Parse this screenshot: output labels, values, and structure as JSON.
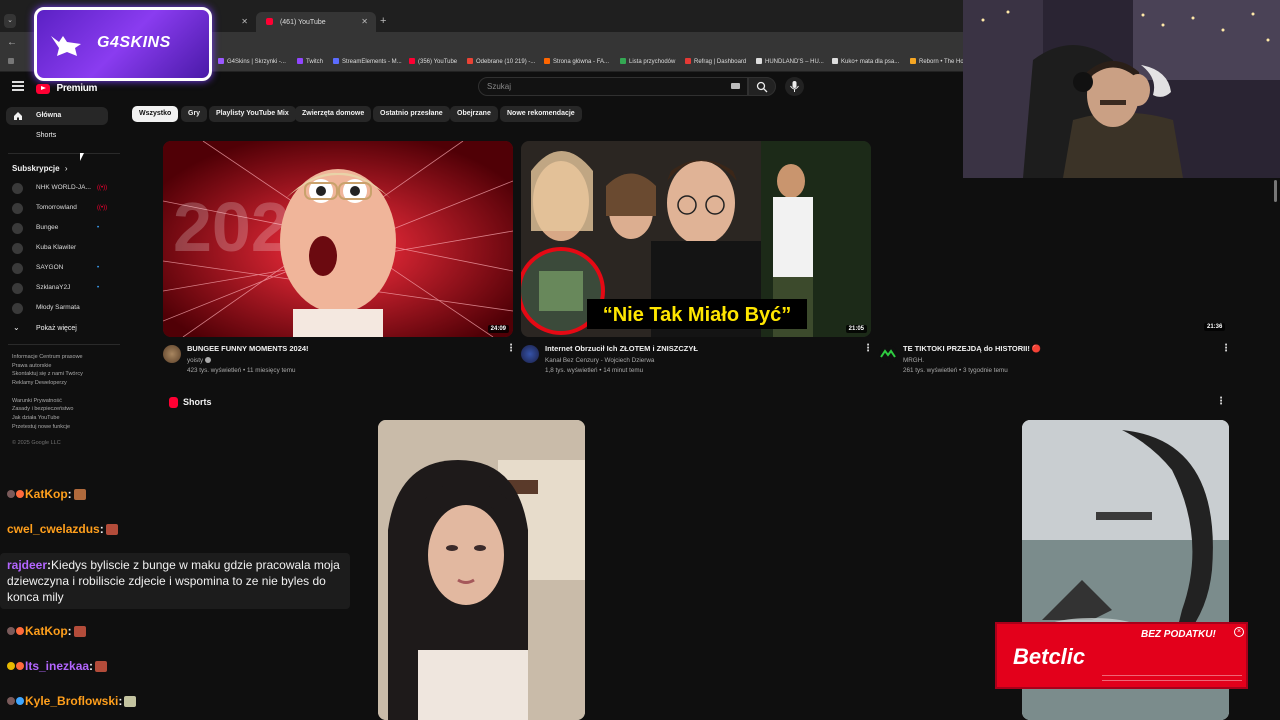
{
  "browser": {
    "tabs": [
      {
        "label": ""
      },
      {
        "label": "(461) YouTube"
      }
    ],
    "new_tab": "+",
    "bookmarks": [
      {
        "label": "G4Skins | Skrzynki -...",
        "color": "#9b59ff"
      },
      {
        "label": "Twitch",
        "color": "#9146ff"
      },
      {
        "label": "StreamElements - M...",
        "color": "#5b6cff"
      },
      {
        "label": "(356) YouTube",
        "color": "#ff0033"
      },
      {
        "label": "Odebrane (10 219) -...",
        "color": "#ea4335"
      },
      {
        "label": "Strona główna - FA...",
        "color": "#ff6600"
      },
      {
        "label": "Lista przychodów",
        "color": "#34a853"
      },
      {
        "label": "Refrag | Dashboard",
        "color": "#e53935"
      },
      {
        "label": "HUNDLAND'S – HU...",
        "color": "#dddddd"
      },
      {
        "label": "Kuko+ mata dla psa...",
        "color": "#dddddd"
      },
      {
        "label": "Reborn • The Ho",
        "color": "#f5a623"
      }
    ]
  },
  "overlay": {
    "g4skins_label": "G4SKINS"
  },
  "youtube": {
    "logo_text": "Premium",
    "search_placeholder": "Szukaj",
    "chips": [
      "Wszystko",
      "Gry",
      "Playlisty YouTube Mix",
      "Zwierzęta domowe",
      "Ostatnio przesłane",
      "Obejrzane",
      "Nowe rekomendacje"
    ],
    "sidebar": {
      "main": [
        {
          "label": "Główna",
          "icon": "home-icon"
        },
        {
          "label": "Shorts",
          "icon": "shorts-icon"
        }
      ],
      "subscriptions_title": "Subskrypcje",
      "subscriptions_arrow": "›",
      "subscriptions": [
        {
          "label": "NHK WORLD-JA...",
          "dot": "((•))",
          "dot_color": "#ff0033"
        },
        {
          "label": "Tomorrowland",
          "dot": "((•))",
          "dot_color": "#ff0033"
        },
        {
          "label": "Bungee",
          "dot": "•",
          "dot_color": "#3ea6ff"
        },
        {
          "label": "Kuba Klawiter",
          "dot": "",
          "dot_color": "#3ea6ff"
        },
        {
          "label": "SAYGON",
          "dot": "•",
          "dot_color": "#3ea6ff"
        },
        {
          "label": "SzklanaY2J",
          "dot": "•",
          "dot_color": "#3ea6ff"
        },
        {
          "label": "Młody Sarmata",
          "dot": "",
          "dot_color": "#3ea6ff"
        }
      ],
      "show_more": "Pokaż więcej",
      "footer_lines": [
        "Informacje  Centrum prasowe",
        "Prawa autorskie",
        "Skontaktuj się z nami  Twórcy",
        "Reklamy  Deweloperzy",
        "",
        "Warunki  Prywatność",
        "Zasady i bezpieczeństwo",
        "Jak działa YouTube",
        "Przetestuj nowe funkcje"
      ],
      "copyright": "© 2025 Google LLC"
    },
    "videos": [
      {
        "title": "BUNGEE FUNNY MOMENTS 2024!",
        "channel": "yoisty",
        "meta": "423 tys. wyświetleń • 11 miesięcy temu",
        "duration": "24:09",
        "thumb_text": "2024"
      },
      {
        "title": "Internet Obrzucił Ich ZŁOTEM i ZNISZCZYŁ",
        "channel": "Kanał Bez Cenzury - Wojciech Dzierwa",
        "meta": "1,8 tys. wyświetleń • 14 minut temu",
        "duration": "21:05",
        "thumb_text": "“Nie Tak Miało Być”"
      },
      {
        "title": "TE TIKTOKI PRZEJDĄ do HISTORII! 🔴",
        "channel": "MRGH.",
        "meta": "261 tys. wyświetleń • 3 tygodnie temu",
        "duration": "21:36",
        "thumb_text": ""
      }
    ],
    "shorts_title": "Shorts"
  },
  "chat": [
    {
      "user": "KatKop",
      "user_color": "#ff9f1c",
      "message": "",
      "sep": ":"
    },
    {
      "user": "cwel_cwelazdus",
      "user_color": "#ff9f1c",
      "message": "",
      "sep": ":"
    },
    {
      "user": "rajdeer",
      "user_color": "#b366ff",
      "message": "Kiedys byliscie z bunge w maku gdzie pracowala moja dziewczyna i robiliscie zdjecie i wspomina to ze nie byles do konca mily",
      "sep": ":"
    },
    {
      "user": "KatKop",
      "user_color": "#ff9f1c",
      "message": "",
      "sep": ":"
    },
    {
      "user": "Its_inezkaa",
      "user_color": "#b366ff",
      "message": "",
      "sep": ":"
    },
    {
      "user": "Kyle_Broflowski",
      "user_color": "#ff9f1c",
      "message": "",
      "sep": ":"
    }
  ],
  "ad": {
    "brand": "Betclic",
    "tagline": "BEZ PODATKU!",
    "close": "×"
  }
}
